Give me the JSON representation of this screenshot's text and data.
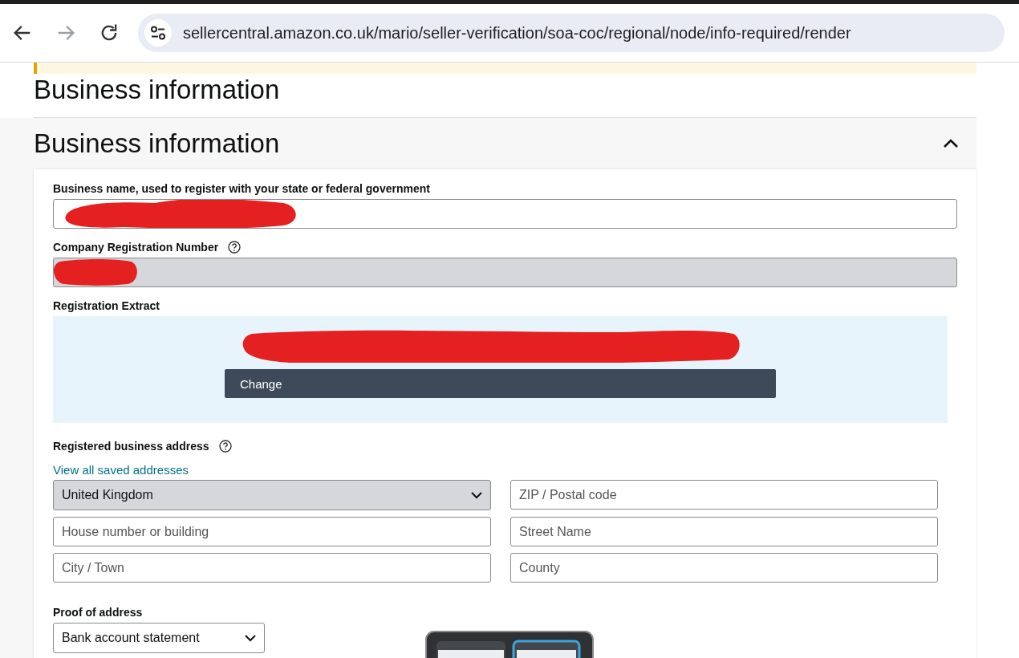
{
  "browser": {
    "url": "sellercentral.amazon.co.uk/mario/seller-verification/soa-coc/regional/node/info-required/render",
    "forward_disabled": true
  },
  "page_title": "Business information",
  "section": {
    "title": "Business information",
    "expanded": true
  },
  "fields": [
    {
      "label": "Business name, used to register with your state or federal government",
      "disabled": false,
      "redacted": true,
      "help": false
    },
    {
      "label": "Company Registration Number",
      "disabled": true,
      "redacted": true,
      "help": true
    }
  ],
  "extract": {
    "label": "Registration Extract",
    "redacted": true,
    "button": "Change"
  },
  "address": {
    "label": "Registered business address",
    "help": true,
    "link": "View all saved addresses",
    "inputs": [
      {
        "kind": "select",
        "value": "United Kingdom",
        "disabled": true
      },
      {
        "kind": "text",
        "placeholder": "ZIP / Postal code"
      },
      {
        "kind": "text",
        "placeholder": "House number or building"
      },
      {
        "kind": "text",
        "placeholder": "Street Name"
      },
      {
        "kind": "text",
        "placeholder": "City / Town"
      },
      {
        "kind": "text",
        "placeholder": "County"
      }
    ]
  },
  "proof": {
    "label": "Proof of address",
    "value": "Bank account statement",
    "kind": "select"
  }
}
